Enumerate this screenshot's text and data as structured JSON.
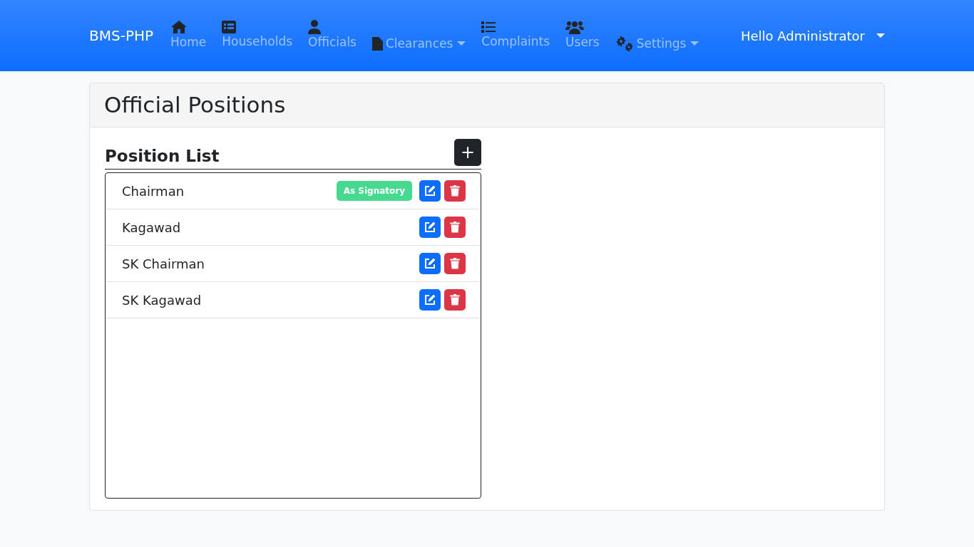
{
  "brand": "BMS-PHP",
  "nav_items": [
    {
      "kind": "link",
      "label": "Home"
    },
    {
      "kind": "link",
      "label": "Households"
    },
    {
      "kind": "link",
      "label": "Officials"
    },
    {
      "kind": "dropdown",
      "label": "Clearances"
    },
    {
      "kind": "link",
      "label": "Complaints"
    },
    {
      "kind": "link",
      "label": "Users"
    },
    {
      "kind": "dropdown",
      "label": "Settings"
    }
  ],
  "user_menu": "Hello Administrator",
  "page_title": "Official Positions",
  "section_title": "Position List",
  "add_button": "+",
  "positions": [
    {
      "name": "Chairman",
      "signatory": true,
      "badge": "As Signatory"
    },
    {
      "name": "Kagawad",
      "signatory": false
    },
    {
      "name": "SK Chairman",
      "signatory": false
    },
    {
      "name": "SK Kagawad",
      "signatory": false
    }
  ]
}
